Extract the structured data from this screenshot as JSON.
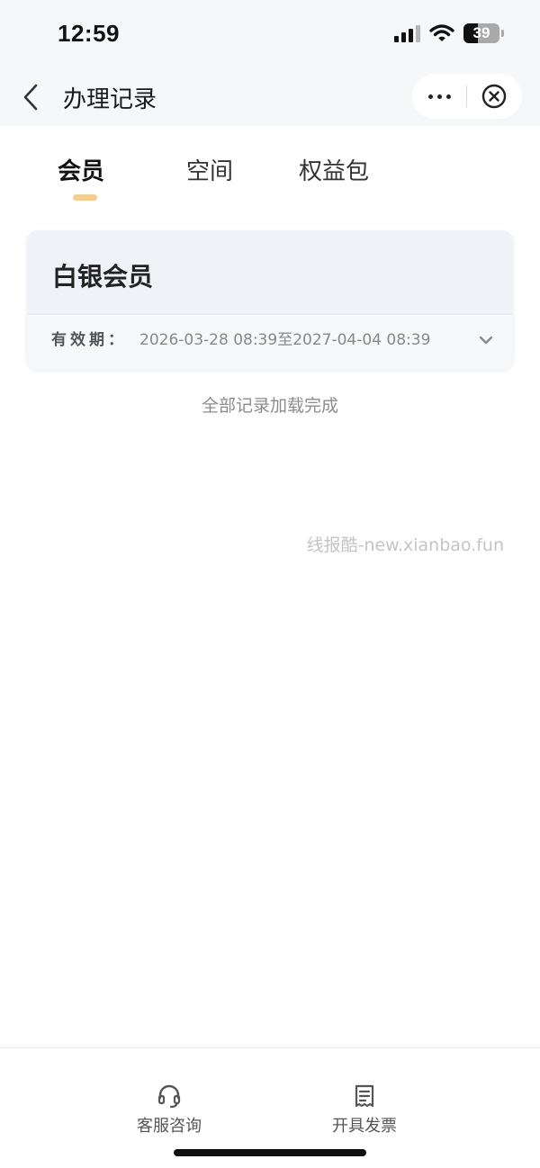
{
  "status_bar": {
    "time": "12:59",
    "battery": "39"
  },
  "nav": {
    "title": "办理记录"
  },
  "tabs": [
    {
      "label": "会员",
      "active": true
    },
    {
      "label": "空间",
      "active": false
    },
    {
      "label": "权益包",
      "active": false
    }
  ],
  "record": {
    "title": "白银会员",
    "validity_label": "有效期：",
    "validity_value": "2026-03-28 08:39至2027-04-04 08:39"
  },
  "list_footer": "全部记录加载完成",
  "watermark": "线报酷-new.xianbao.fun",
  "bottom_actions": [
    {
      "label": "客服咨询",
      "icon": "headset-icon"
    },
    {
      "label": "开具发票",
      "icon": "invoice-icon"
    }
  ],
  "colors": {
    "tab_indicator": "#f5cd8f",
    "nav_bg": "#f6f7f9",
    "card_head_bg": "#eff2f6"
  }
}
